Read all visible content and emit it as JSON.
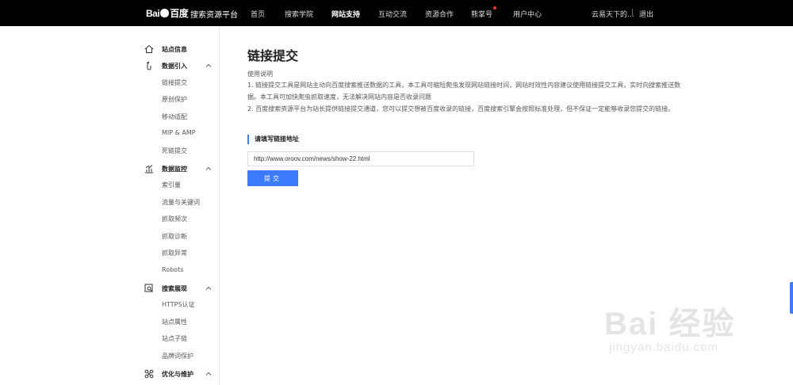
{
  "topbar": {
    "logo_bai": "Bai",
    "logo_du": "百度",
    "platform": "搜索资源平台",
    "nav": [
      {
        "label": "首页",
        "active": false,
        "dot": false
      },
      {
        "label": "搜索学院",
        "active": false,
        "dot": false
      },
      {
        "label": "网站支持",
        "active": true,
        "dot": false
      },
      {
        "label": "互动交流",
        "active": false,
        "dot": false
      },
      {
        "label": "资源合作",
        "active": false,
        "dot": false
      },
      {
        "label": "熊掌号",
        "active": false,
        "dot": true
      },
      {
        "label": "用户中心",
        "active": false,
        "dot": false
      }
    ],
    "user_name": "云易天下的...",
    "separator": "|",
    "logout": "退出"
  },
  "sidebar": {
    "groups": [
      {
        "label": "站点信息",
        "icon": "home-icon",
        "expandable": false,
        "items": []
      },
      {
        "label": "数据引入",
        "icon": "data-import-icon",
        "expandable": true,
        "items": [
          "链接提交",
          "原创保护",
          "移动适配",
          "MIP & AMP",
          "死链提交"
        ]
      },
      {
        "label": "数据监控",
        "icon": "bar-chart-icon",
        "expandable": true,
        "items": [
          "索引量",
          "流量与关键词",
          "抓取频次",
          "抓取诊断",
          "抓取异常",
          "Robots"
        ]
      },
      {
        "label": "搜索展现",
        "icon": "search-display-icon",
        "expandable": true,
        "items": [
          "HTTPS认证",
          "站点属性",
          "站点子链",
          "品牌词保护"
        ]
      },
      {
        "label": "优化与维护",
        "icon": "optimize-icon",
        "expandable": true,
        "items": []
      }
    ]
  },
  "main": {
    "title": "链接提交",
    "desc_head": "使用说明",
    "desc_1": "1. 链接提交工具是网站主动向百度搜索推送数据的工具，本工具可缩短爬虫发现网站链接时间，网站时效性内容建议使用链接提交工具，实时向搜索推送数据。本工具可加快爬虫抓取速度，无法解决网站内容是否收录问题",
    "desc_2": "2. 百度搜索资源平台为站长提供链接提交通道，您可以提交想被百度收录的链接，百度搜索引擎会按照标准处理，但不保证一定能够收录您提交的链接。",
    "section_label": "请填写链接地址",
    "url_value": "http://www.oroov.com/news/show-22.html",
    "submit_label": "提交"
  },
  "watermark": {
    "brand": "Bai 经验",
    "url": "jingyan.baidu.com"
  },
  "colors": {
    "topbar": "#000000",
    "accent": "#3b7cff",
    "notify_dot": "#e33333"
  }
}
